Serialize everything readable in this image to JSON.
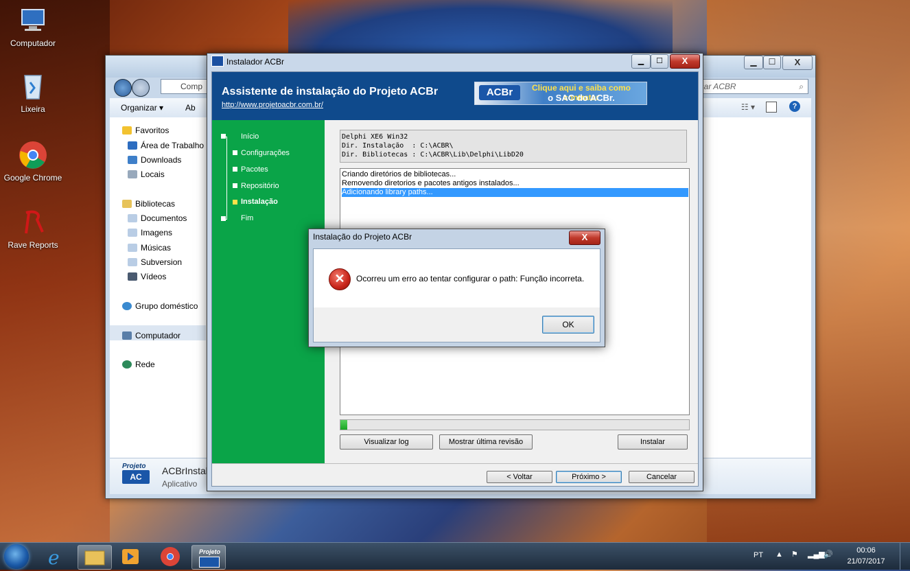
{
  "desktop": {
    "icons": [
      {
        "label": "Computador"
      },
      {
        "label": "Lixeira"
      },
      {
        "label": "Google Chrome"
      },
      {
        "label": "Rave Reports"
      }
    ]
  },
  "explorer": {
    "address": "Comp",
    "search_placeholder": "isar ACBR",
    "toolbar": {
      "organize": "Organizar ▾",
      "open": "Ab"
    },
    "nav": {
      "favorites": "Favoritos",
      "desktop": "Área de Trabalho",
      "downloads": "Downloads",
      "locais": "Locais",
      "libraries": "Bibliotecas",
      "documents": "Documentos",
      "images": "Imagens",
      "music": "Músicas",
      "subversion": "Subversion",
      "videos": "Vídeos",
      "homegroup": "Grupo doméstico",
      "computer": "Computador",
      "network": "Rede"
    },
    "details": {
      "name": "ACBrInstall",
      "type": "Aplicativo",
      "logo_top": "Projeto",
      "logo_bottom": "AC"
    }
  },
  "installer": {
    "window_title": "Instalador ACBr",
    "header_title": "Assistente de instalação do Projeto ACBr",
    "header_link": "http://www.projetoacbr.com.br/",
    "banner": {
      "logo": "ACBr",
      "line1": "Clique aqui e saiba como contratar",
      "line2": "o SAC do ACBr."
    },
    "steps": [
      "Início",
      "Configurações",
      "Pacotes",
      "Repositório",
      "Instalação",
      "Fim"
    ],
    "active_step": "Instalação",
    "config_lines": [
      "Delphi XE6 Win32",
      "Dir. Instalação  : C:\\ACBR\\",
      "Dir. Bibliotecas : C:\\ACBR\\Lib\\Delphi\\LibD20"
    ],
    "log_lines": [
      "Criando diretórios de bibliotecas...",
      "Removendo diretorios e pacotes antigos instalados...",
      "Adicionando library paths..."
    ],
    "progress_fraction": 0.02,
    "buttons": {
      "view_log": "Visualizar log",
      "show_revision": "Mostrar última revisão",
      "install": "Instalar",
      "back": "< Voltar",
      "next": "Próximo >",
      "cancel": "Cancelar"
    }
  },
  "message": {
    "title": "Instalação do Projeto ACBr",
    "text": "Ocorreu um erro ao tentar configurar o path: Função incorreta.",
    "ok": "OK",
    "close": "X"
  },
  "taskbar": {
    "language": "PT",
    "time": "00:06",
    "date": "21/07/2017",
    "app_label": "Projeto"
  },
  "colors": {
    "installer_header": "#0f4a8c",
    "installer_sidebar": "#0aa448",
    "selection": "#3399ff"
  }
}
